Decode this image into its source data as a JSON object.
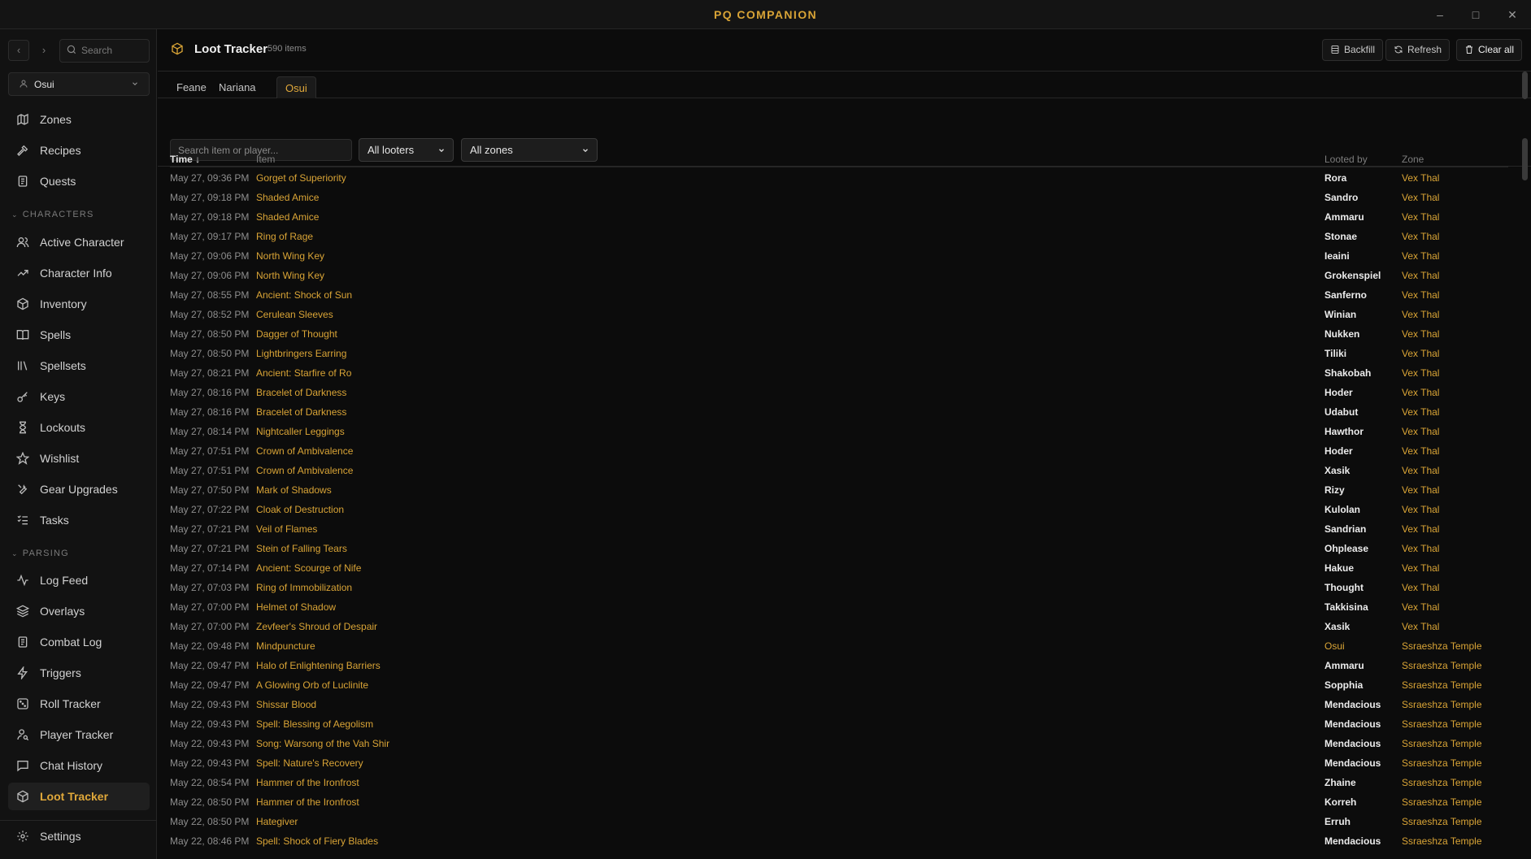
{
  "window": {
    "title": "PQ COMPANION",
    "minimize": "–",
    "maximize": "□",
    "close": "✕"
  },
  "sidebar": {
    "search_placeholder": "Search",
    "character": "Osui",
    "top_items": [
      {
        "label": "Zones",
        "icon": "map-icon"
      },
      {
        "label": "Recipes",
        "icon": "hammer-icon"
      },
      {
        "label": "Quests",
        "icon": "scroll-icon"
      }
    ],
    "characters_section": "CHARACTERS",
    "character_items": [
      {
        "label": "Active Character",
        "icon": "users-icon"
      },
      {
        "label": "Character Info",
        "icon": "trending-icon"
      },
      {
        "label": "Inventory",
        "icon": "package-icon"
      },
      {
        "label": "Spells",
        "icon": "book-icon"
      },
      {
        "label": "Spellsets",
        "icon": "library-icon"
      },
      {
        "label": "Keys",
        "icon": "key-icon"
      },
      {
        "label": "Lockouts",
        "icon": "hourglass-icon"
      },
      {
        "label": "Wishlist",
        "icon": "star-icon"
      },
      {
        "label": "Gear Upgrades",
        "icon": "wrench-icon"
      },
      {
        "label": "Tasks",
        "icon": "checklist-icon"
      }
    ],
    "parsing_section": "PARSING",
    "parsing_items": [
      {
        "label": "Log Feed",
        "icon": "activity-icon"
      },
      {
        "label": "Overlays",
        "icon": "layers-icon"
      },
      {
        "label": "Combat Log",
        "icon": "scroll-icon"
      },
      {
        "label": "Triggers",
        "icon": "zap-icon"
      },
      {
        "label": "Roll Tracker",
        "icon": "dice-icon"
      },
      {
        "label": "Player Tracker",
        "icon": "user-search-icon"
      },
      {
        "label": "Chat History",
        "icon": "chat-icon"
      },
      {
        "label": "Loot Tracker",
        "icon": "package-icon"
      }
    ],
    "settings": "Settings"
  },
  "header": {
    "title": "Loot Tracker",
    "count": "590 items",
    "backfill": "Backfill",
    "refresh": "Refresh",
    "clear_all": "Clear all"
  },
  "tabs": [
    "Feane",
    "Nariana",
    "Osui"
  ],
  "active_tab": "Osui",
  "filters": {
    "search_placeholder": "Search item or player...",
    "looters": "All looters",
    "zones": "All zones"
  },
  "table": {
    "columns": {
      "time": "Time ↓",
      "item": "Item",
      "looter": "Looted by",
      "zone": "Zone"
    },
    "rows": [
      {
        "time": "May 27, 09:36 PM",
        "item": "Gorget of Superiority",
        "looter": "Rora",
        "zone": "Vex Thal"
      },
      {
        "time": "May 27, 09:18 PM",
        "item": "Shaded Amice",
        "looter": "Sandro",
        "zone": "Vex Thal"
      },
      {
        "time": "May 27, 09:18 PM",
        "item": "Shaded Amice",
        "looter": "Ammaru",
        "zone": "Vex Thal"
      },
      {
        "time": "May 27, 09:17 PM",
        "item": "Ring of Rage",
        "looter": "Stonae",
        "zone": "Vex Thal"
      },
      {
        "time": "May 27, 09:06 PM",
        "item": "North Wing Key",
        "looter": "Ieaini",
        "zone": "Vex Thal"
      },
      {
        "time": "May 27, 09:06 PM",
        "item": "North Wing Key",
        "looter": "Grokenspiel",
        "zone": "Vex Thal"
      },
      {
        "time": "May 27, 08:55 PM",
        "item": "Ancient: Shock of Sun",
        "looter": "Sanferno",
        "zone": "Vex Thal"
      },
      {
        "time": "May 27, 08:52 PM",
        "item": "Cerulean Sleeves",
        "looter": "Winian",
        "zone": "Vex Thal"
      },
      {
        "time": "May 27, 08:50 PM",
        "item": "Dagger of Thought",
        "looter": "Nukken",
        "zone": "Vex Thal"
      },
      {
        "time": "May 27, 08:50 PM",
        "item": "Lightbringers Earring",
        "looter": "Tiliki",
        "zone": "Vex Thal"
      },
      {
        "time": "May 27, 08:21 PM",
        "item": "Ancient: Starfire of Ro",
        "looter": "Shakobah",
        "zone": "Vex Thal"
      },
      {
        "time": "May 27, 08:16 PM",
        "item": "Bracelet of Darkness",
        "looter": "Hoder",
        "zone": "Vex Thal"
      },
      {
        "time": "May 27, 08:16 PM",
        "item": "Bracelet of Darkness",
        "looter": "Udabut",
        "zone": "Vex Thal"
      },
      {
        "time": "May 27, 08:14 PM",
        "item": "Nightcaller Leggings",
        "looter": "Hawthor",
        "zone": "Vex Thal"
      },
      {
        "time": "May 27, 07:51 PM",
        "item": "Crown of Ambivalence",
        "looter": "Hoder",
        "zone": "Vex Thal"
      },
      {
        "time": "May 27, 07:51 PM",
        "item": "Crown of Ambivalence",
        "looter": "Xasik",
        "zone": "Vex Thal"
      },
      {
        "time": "May 27, 07:50 PM",
        "item": "Mark of Shadows",
        "looter": "Rizy",
        "zone": "Vex Thal"
      },
      {
        "time": "May 27, 07:22 PM",
        "item": "Cloak of Destruction",
        "looter": "Kulolan",
        "zone": "Vex Thal"
      },
      {
        "time": "May 27, 07:21 PM",
        "item": "Veil of Flames",
        "looter": "Sandrian",
        "zone": "Vex Thal"
      },
      {
        "time": "May 27, 07:21 PM",
        "item": "Stein of Falling Tears",
        "looter": "Ohplease",
        "zone": "Vex Thal"
      },
      {
        "time": "May 27, 07:14 PM",
        "item": "Ancient: Scourge of Nife",
        "looter": "Hakue",
        "zone": "Vex Thal"
      },
      {
        "time": "May 27, 07:03 PM",
        "item": "Ring of Immobilization",
        "looter": "Thought",
        "zone": "Vex Thal"
      },
      {
        "time": "May 27, 07:00 PM",
        "item": "Helmet of Shadow",
        "looter": "Takkisina",
        "zone": "Vex Thal"
      },
      {
        "time": "May 27, 07:00 PM",
        "item": "Zevfeer's Shroud of Despair",
        "looter": "Xasik",
        "zone": "Vex Thal"
      },
      {
        "time": "May 22, 09:48 PM",
        "item": "Mindpuncture",
        "looter": "Osui",
        "zone": "Ssraeshza Temple",
        "self": true
      },
      {
        "time": "May 22, 09:47 PM",
        "item": "Halo of Enlightening Barriers",
        "looter": "Ammaru",
        "zone": "Ssraeshza Temple"
      },
      {
        "time": "May 22, 09:47 PM",
        "item": "A Glowing Orb of Luclinite",
        "looter": "Sopphia",
        "zone": "Ssraeshza Temple"
      },
      {
        "time": "May 22, 09:43 PM",
        "item": "Shissar Blood",
        "looter": "Mendacious",
        "zone": "Ssraeshza Temple"
      },
      {
        "time": "May 22, 09:43 PM",
        "item": "Spell: Blessing of Aegolism",
        "looter": "Mendacious",
        "zone": "Ssraeshza Temple"
      },
      {
        "time": "May 22, 09:43 PM",
        "item": "Song: Warsong of the Vah Shir",
        "looter": "Mendacious",
        "zone": "Ssraeshza Temple"
      },
      {
        "time": "May 22, 09:43 PM",
        "item": "Spell: Nature's Recovery",
        "looter": "Mendacious",
        "zone": "Ssraeshza Temple"
      },
      {
        "time": "May 22, 08:54 PM",
        "item": "Hammer of the Ironfrost",
        "looter": "Zhaine",
        "zone": "Ssraeshza Temple"
      },
      {
        "time": "May 22, 08:50 PM",
        "item": "Hammer of the Ironfrost",
        "looter": "Korreh",
        "zone": "Ssraeshza Temple"
      },
      {
        "time": "May 22, 08:50 PM",
        "item": "Hategiver",
        "looter": "Erruh",
        "zone": "Ssraeshza Temple"
      },
      {
        "time": "May 22, 08:46 PM",
        "item": "Spell: Shock of Fiery Blades",
        "looter": "Mendacious",
        "zone": "Ssraeshza Temple"
      }
    ]
  },
  "colors": {
    "accent": "#d9a436",
    "background": "#0c0c0c",
    "sidebar": "#121212"
  }
}
